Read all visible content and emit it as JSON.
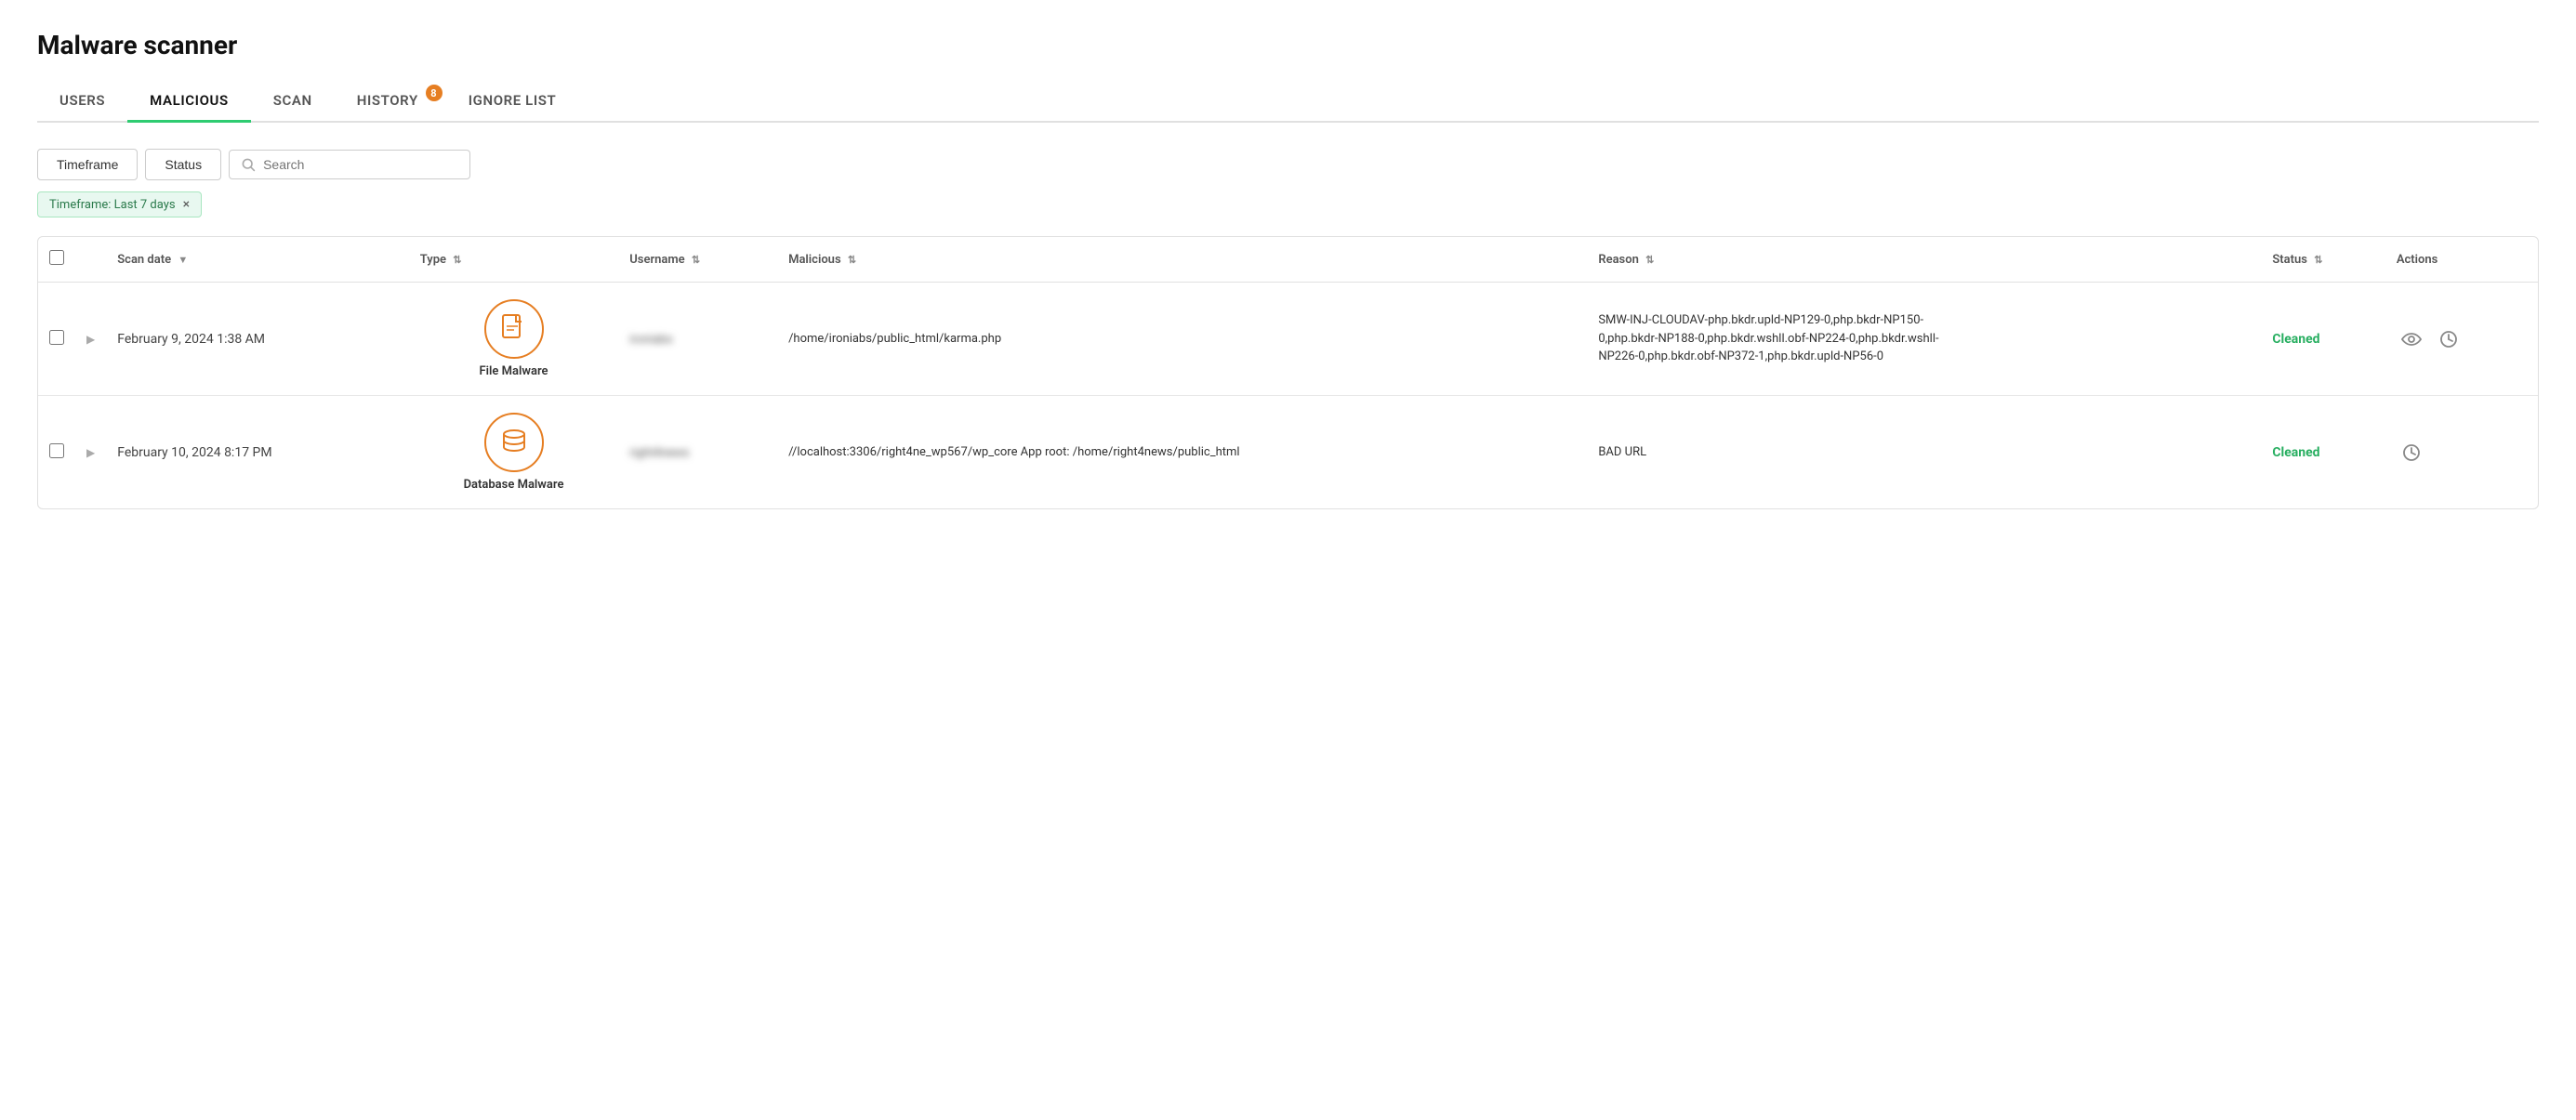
{
  "page": {
    "title": "Malware scanner"
  },
  "tabs": [
    {
      "id": "users",
      "label": "USERS",
      "active": false,
      "badge": null
    },
    {
      "id": "malicious",
      "label": "MALICIOUS",
      "active": true,
      "badge": null
    },
    {
      "id": "scan",
      "label": "SCAN",
      "active": false,
      "badge": null
    },
    {
      "id": "history",
      "label": "HISTORY",
      "active": false,
      "badge": 8
    },
    {
      "id": "ignore-list",
      "label": "IGNORE LIST",
      "active": false,
      "badge": null
    }
  ],
  "filters": {
    "timeframe_label": "Timeframe",
    "status_label": "Status",
    "search_placeholder": "Search",
    "active_filter": "Timeframe: Last 7 days"
  },
  "table": {
    "columns": [
      {
        "id": "checkbox",
        "label": ""
      },
      {
        "id": "expand",
        "label": ""
      },
      {
        "id": "scan_date",
        "label": "Scan date",
        "sortable": true
      },
      {
        "id": "type",
        "label": "Type",
        "sortable": true
      },
      {
        "id": "username",
        "label": "Username",
        "sortable": true
      },
      {
        "id": "malicious",
        "label": "Malicious",
        "sortable": true
      },
      {
        "id": "reason",
        "label": "Reason",
        "sortable": true
      },
      {
        "id": "status",
        "label": "Status",
        "sortable": true
      },
      {
        "id": "actions",
        "label": "Actions",
        "sortable": false
      }
    ],
    "rows": [
      {
        "scan_date": "February 9, 2024 1:38 AM",
        "type_label": "File Malware",
        "type_icon": "file",
        "username": "ironiabs",
        "malicious": "/home/ironiabs/public_html/karma.php",
        "reason": "SMW-INJ-CLOUDAV-php.bkdr.upld-NP129-0,php.bkdr-NP150-0,php.bkdr-NP188-0,php.bkdr.wshll.obf-NP224-0,php.bkdr.wshll-NP226-0,php.bkdr.obf-NP372-1,php.bkdr.upld-NP56-0",
        "status": "Cleaned",
        "status_color": "#27ae60"
      },
      {
        "scan_date": "February 10, 2024 8:17 PM",
        "type_label": "Database Malware",
        "type_icon": "database",
        "username": "right4news",
        "malicious": "//localhost:3306/right4ne_wp567/wp_core\nApp root: /home/right4news/public_html",
        "reason": "BAD URL",
        "status": "Cleaned",
        "status_color": "#27ae60"
      }
    ]
  },
  "icons": {
    "search": "🔍",
    "sort": "⇅",
    "eye": "👁",
    "history": "🕐",
    "expand": "▶"
  }
}
